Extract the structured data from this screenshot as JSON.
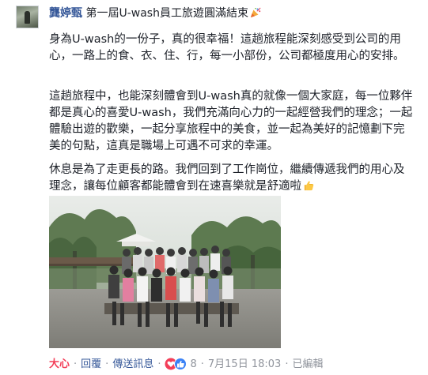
{
  "post": {
    "author": "龔婷甄",
    "title": "第一屆U-wash員工旅遊圓滿結束",
    "title_emoji": "party-popper-icon",
    "paragraphs": [
      "身為U-wash的一份子，真的很幸福！這趟旅程能深刻感受到公司的用心，一路上的食、衣、住、行，每一小部份，公司都極度用心的安排。",
      "這趟旅程中，也能深刻體會到U-wash真的就像一個大家庭，每一位夥伴都是真心的喜愛U-wash，我們充滿向心力的一起經營我們的理念；一起體驗出遊的歡樂，一起分享旅程中的美食，並一起為美好的記憶劃下完美的句點，這真是職場上可遇不可求的幸運。",
      "休息是為了走更長的路。我們回到了工作崗位，繼續傳遞我們的用心及理念，讓每位顧客都能體會到在速喜樂就是舒適啦"
    ],
    "paragraph3_emoji": "thumbs-up-icon",
    "photo_label": "group-photo"
  },
  "actions": {
    "reaction_label": "大心",
    "reply_label": "回覆",
    "send_message_label": "傳送訊息",
    "reaction_icons": [
      "love-reaction-icon",
      "like-reaction-icon"
    ],
    "reaction_count": "8",
    "date": "7月15日",
    "time": "18:03",
    "edited_label": "已編輯",
    "separator": "·"
  },
  "colors": {
    "link": "#365899",
    "love_reaction": "#f33e58",
    "text": "#1d2129",
    "muted": "#90949c"
  }
}
